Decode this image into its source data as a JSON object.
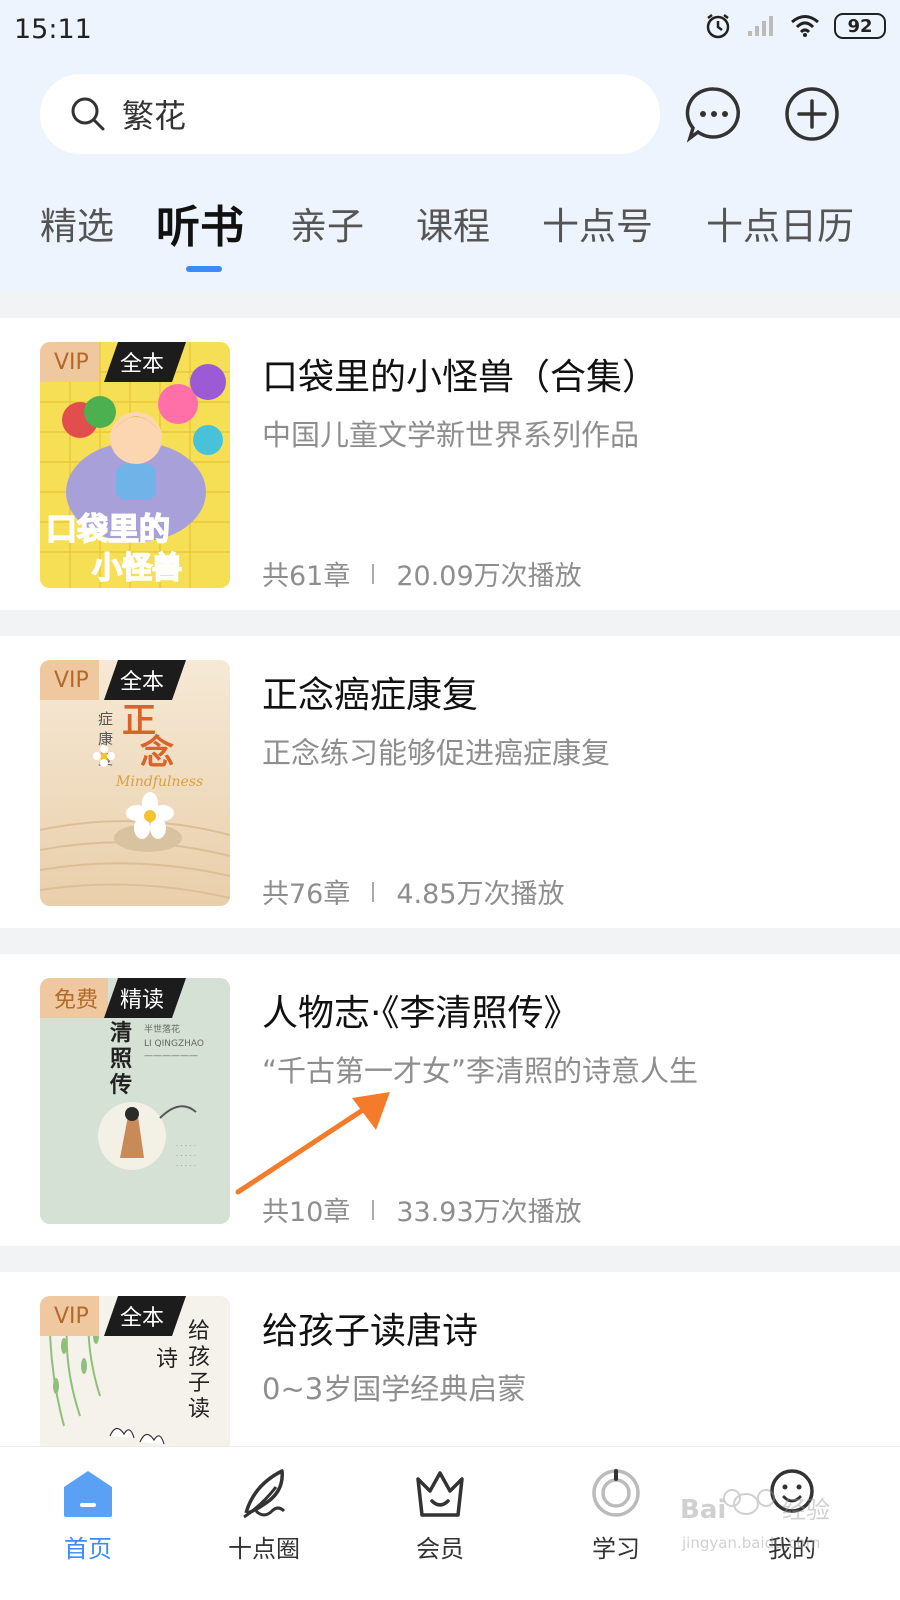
{
  "status_bar": {
    "time": "15:11",
    "battery": "92"
  },
  "search": {
    "text": "繁花"
  },
  "tabs": [
    {
      "label": "精选"
    },
    {
      "label": "听书"
    },
    {
      "label": "亲子"
    },
    {
      "label": "课程"
    },
    {
      "label": "十点号"
    },
    {
      "label": "十点日历"
    }
  ],
  "books": [
    {
      "badge_left": "VIP",
      "badge_right": "全本",
      "title": "口袋里的小怪兽（合集）",
      "desc": "中国儿童文学新世界系列作品",
      "chapters": "共61章",
      "plays": "20.09万次播放",
      "cover_text": "口袋里的小怪兽"
    },
    {
      "badge_left": "VIP",
      "badge_right": "全本",
      "title": "正念癌症康复",
      "desc": "正念练习能够促进癌症康复",
      "chapters": "共76章",
      "plays": "4.85万次播放",
      "cover_text": "正念 癌症康复"
    },
    {
      "badge_left": "免费",
      "badge_right": "精读",
      "title": "人物志·《李清照传》",
      "desc": "“千古第一才女”李清照的诗意人生",
      "chapters": "共10章",
      "plays": "33.93万次播放",
      "cover_text": "清照传"
    },
    {
      "badge_left": "VIP",
      "badge_right": "全本",
      "title": "给孩子读唐诗",
      "desc": "0~3岁国学经典启蒙",
      "chapters": "",
      "plays": "",
      "cover_text": "给孩子读 诗"
    }
  ],
  "bottom_nav": [
    {
      "label": "首页",
      "icon": "home-icon"
    },
    {
      "label": "十点圈",
      "icon": "feather-icon"
    },
    {
      "label": "会员",
      "icon": "crown-icon"
    },
    {
      "label": "学习",
      "icon": "study-icon"
    },
    {
      "label": "我的",
      "icon": "profile-icon"
    }
  ],
  "colors": {
    "accent": "#3b8cf4",
    "vip_badge_bg": "#f0c8a0",
    "vip_badge_text": "#b26a2a",
    "annotation_arrow": "#f47b2a"
  }
}
